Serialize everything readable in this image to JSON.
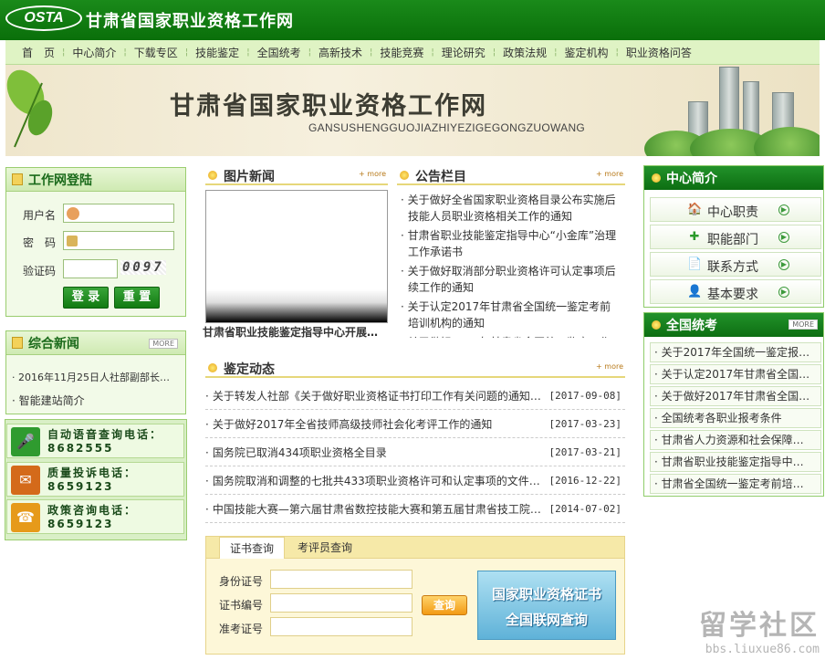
{
  "header": {
    "logo": "OSTA",
    "title": "甘肃省国家职业资格工作网"
  },
  "nav": [
    "首　页",
    "中心简介",
    "下载专区",
    "技能鉴定",
    "全国统考",
    "高新技术",
    "技能竞赛",
    "理论研究",
    "政策法规",
    "鉴定机构",
    "职业资格问答"
  ],
  "banner": {
    "title": "甘肃省国家职业资格工作网",
    "subtitle": "GANSUSHENGGUOJIAZHIYEZIGEGONGZUOWANG"
  },
  "login": {
    "title": "工作网登陆",
    "username_label": "用户名",
    "password_label": "密　码",
    "captcha_label": "验证码",
    "captcha_text": "0097",
    "login_button": "登 录",
    "reset_button": "重 置"
  },
  "combined_news": {
    "title": "综合新闻",
    "more": "MORE",
    "items": [
      "2016年11月25日人社部副部长…",
      "智能建站简介"
    ]
  },
  "phones": [
    {
      "label": "自动语音查询电话：",
      "number": "8682555",
      "icon": "microphone-icon"
    },
    {
      "label": "质量投诉电话：",
      "number": "8659123",
      "icon": "mailbox-icon"
    },
    {
      "label": "政策咨询电话：",
      "number": "8659123",
      "icon": "telephone-icon"
    }
  ],
  "photo_news": {
    "title": "图片新闻",
    "more": "+ more",
    "caption": "甘肃省职业技能鉴定指导中心开展…"
  },
  "notice": {
    "title": "公告栏目",
    "more": "+ more",
    "items": [
      "关于做好全省国家职业资格目录公布实施后技能人员职业资格相关工作的通知",
      "甘肃省职业技能鉴定指导中心“小金库”治理工作承诺书",
      "关于做好取消部分职业资格许可认定事项后续工作的通知",
      "关于认定2017年甘肃省全国统一鉴定考前培训机构的通知",
      "关于做好2017年甘肃省全国统一鉴定工作的"
    ]
  },
  "appraisal": {
    "title": "鉴定动态",
    "more": "+ more",
    "items": [
      {
        "title": "关于转发人社部《关于做好职业资格证书打印工作有关问题的通知…",
        "date": "[2017-09-08]"
      },
      {
        "title": "关于做好2017年全省技师高级技师社会化考评工作的通知",
        "date": "[2017-03-23]"
      },
      {
        "title": "国务院已取消434项职业资格全目录",
        "date": "[2017-03-21]"
      },
      {
        "title": "国务院取消和调整的七批共433项职业资格许可和认定事项的文件…",
        "date": "[2016-12-22]"
      },
      {
        "title": "中国技能大赛—第六届甘肃省数控技能大赛和第五届甘肃省技工院…",
        "date": "[2014-07-02]"
      }
    ]
  },
  "query": {
    "tab_certificate": "证书查询",
    "tab_examiner": "考评员查询",
    "id_label": "身份证号",
    "cert_label": "证书编号",
    "exam_label": "准考证号",
    "query_button": "查询",
    "banner_line1": "国家职业资格证书",
    "banner_line2": "全国联网查询"
  },
  "center_intro": {
    "title": "中心简介",
    "items": [
      {
        "label": "中心职责",
        "icon": "house-icon"
      },
      {
        "label": "职能部门",
        "icon": "plus-icon"
      },
      {
        "label": "联系方式",
        "icon": "document-icon"
      },
      {
        "label": "基本要求",
        "icon": "user-icon"
      }
    ]
  },
  "national_exam": {
    "title": "全国统考",
    "more": "MORE",
    "items": [
      "关于2017年全国统一鉴定报…",
      "关于认定2017年甘肃省全国…",
      "关于做好2017年甘肃省全国…",
      "全国统考各职业报考条件",
      "甘肃省人力资源和社会保障…",
      "甘肃省职业技能鉴定指导中…",
      "甘肃省全国统一鉴定考前培…"
    ]
  },
  "watermark": {
    "brand": "留学社区",
    "url": "bbs.liuxue86.com"
  },
  "colors": {
    "brand_green": "#0a6f0a",
    "nav_bg": "#dff3c4",
    "accent_gold": "#e6a51a"
  }
}
